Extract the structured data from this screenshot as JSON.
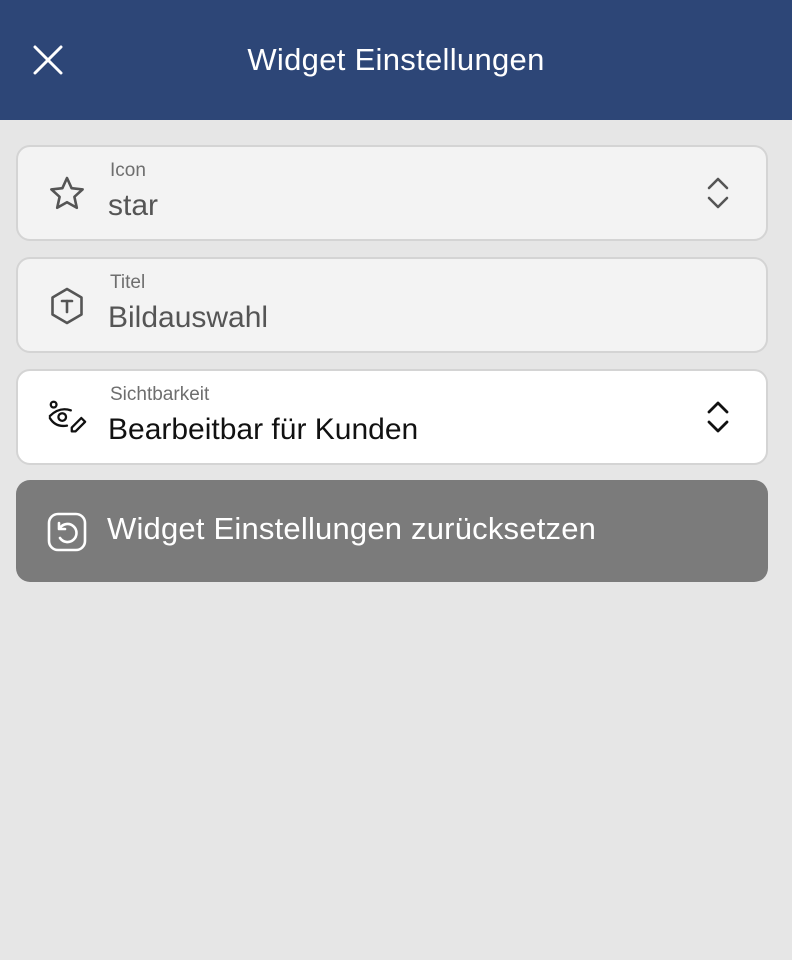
{
  "header": {
    "title": "Widget Einstellungen",
    "close_icon": "close-icon"
  },
  "fields": {
    "icon": {
      "label": "Icon",
      "value": "star",
      "icon": "star-icon"
    },
    "title": {
      "label": "Titel",
      "value": "Bildauswahl",
      "icon": "text-hexagon-icon"
    },
    "visibility": {
      "label": "Sichtbarkeit",
      "value": "Bearbeitbar für Kunden",
      "icon": "edit-visibility-icon"
    }
  },
  "reset": {
    "label": "Widget Einstellungen zurücksetzen",
    "icon": "reset-icon"
  },
  "colors": {
    "header_bg": "#2d4677",
    "page_bg": "#e6e6e6",
    "reset_bg": "#7b7b7b"
  }
}
